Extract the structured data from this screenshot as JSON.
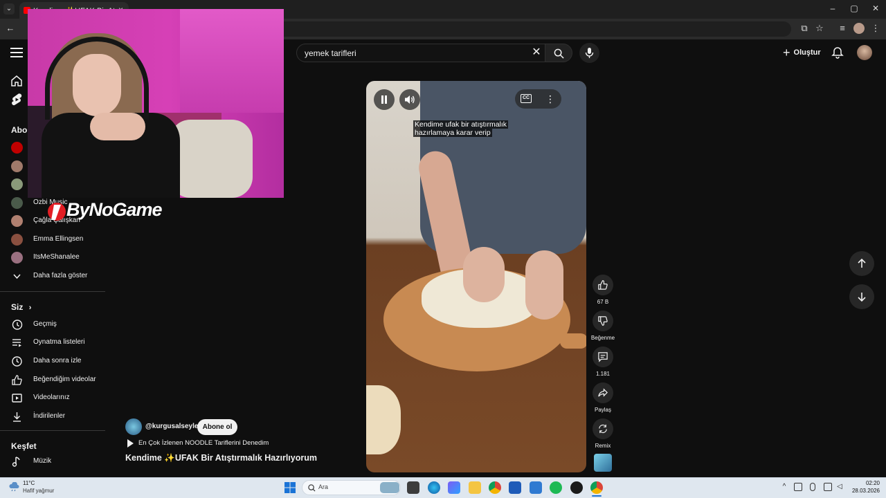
{
  "browser": {
    "tab_title": "Kendime ✨UFAK Bir Atıştı…",
    "tab_close": "×",
    "tab_dropdown": "⌄",
    "window_minimize": "–",
    "window_restore": "▢",
    "window_close": "✕"
  },
  "header": {
    "search_value": "yemek tarifleri",
    "create_label": "Oluştur"
  },
  "sidebar": {
    "subscriptions_title": "Abonelikler",
    "channels": [
      {
        "label": "",
        "color": "#c00000"
      },
      {
        "label": "",
        "color": "#a07a6a"
      },
      {
        "label": "",
        "color": "#8a9a7a"
      },
      {
        "label": "Ozbi Music",
        "color": "#4a5a4a"
      },
      {
        "label": "Çağla Çalışkan",
        "color": "#b08070"
      },
      {
        "label": "Emma Ellingsen",
        "color": "#8a5040"
      },
      {
        "label": "ItsMeShanalee",
        "color": "#9a7080"
      }
    ],
    "show_more": "Daha fazla göster",
    "you_title": "Siz",
    "you_items": [
      "Geçmiş",
      "Oynatma listeleri",
      "Daha sonra izle",
      "Beğendiğim videolar",
      "Videolarınız",
      "İndirilenler"
    ],
    "explore_title": "Keşfet",
    "explore_items": [
      "Müzik"
    ]
  },
  "overlay": {
    "logo_text": "ByNoGame"
  },
  "video": {
    "caption_line1": "Kendime ufak bir atıştırmalık",
    "caption_line2": "hazırlamaya karar verip",
    "cc_label": "CC",
    "channel_handle": "@kurgusalseyler",
    "subscribe_label": "Abone ol",
    "playlist_label": "En Çok İzlenen NOODLE Tariflerini Denedim",
    "title": "Kendime ✨UFAK Bir Atıştırmalık Hazırlıyorum"
  },
  "actions": {
    "like_count": "67 B",
    "dislike_label": "Beğenme",
    "comment_count": "1.181",
    "share_label": "Paylaş",
    "remix_label": "Remix"
  },
  "taskbar": {
    "weather_temp": "11°C",
    "weather_desc": "Hafif yağmur",
    "search_placeholder": "Ara",
    "time": "02:20",
    "date": "28.03.2026"
  },
  "colors": {
    "background": "#0f0f0f",
    "accent_red": "#ff0000",
    "chip": "#272727",
    "taskbar": "#dfe7ef"
  }
}
